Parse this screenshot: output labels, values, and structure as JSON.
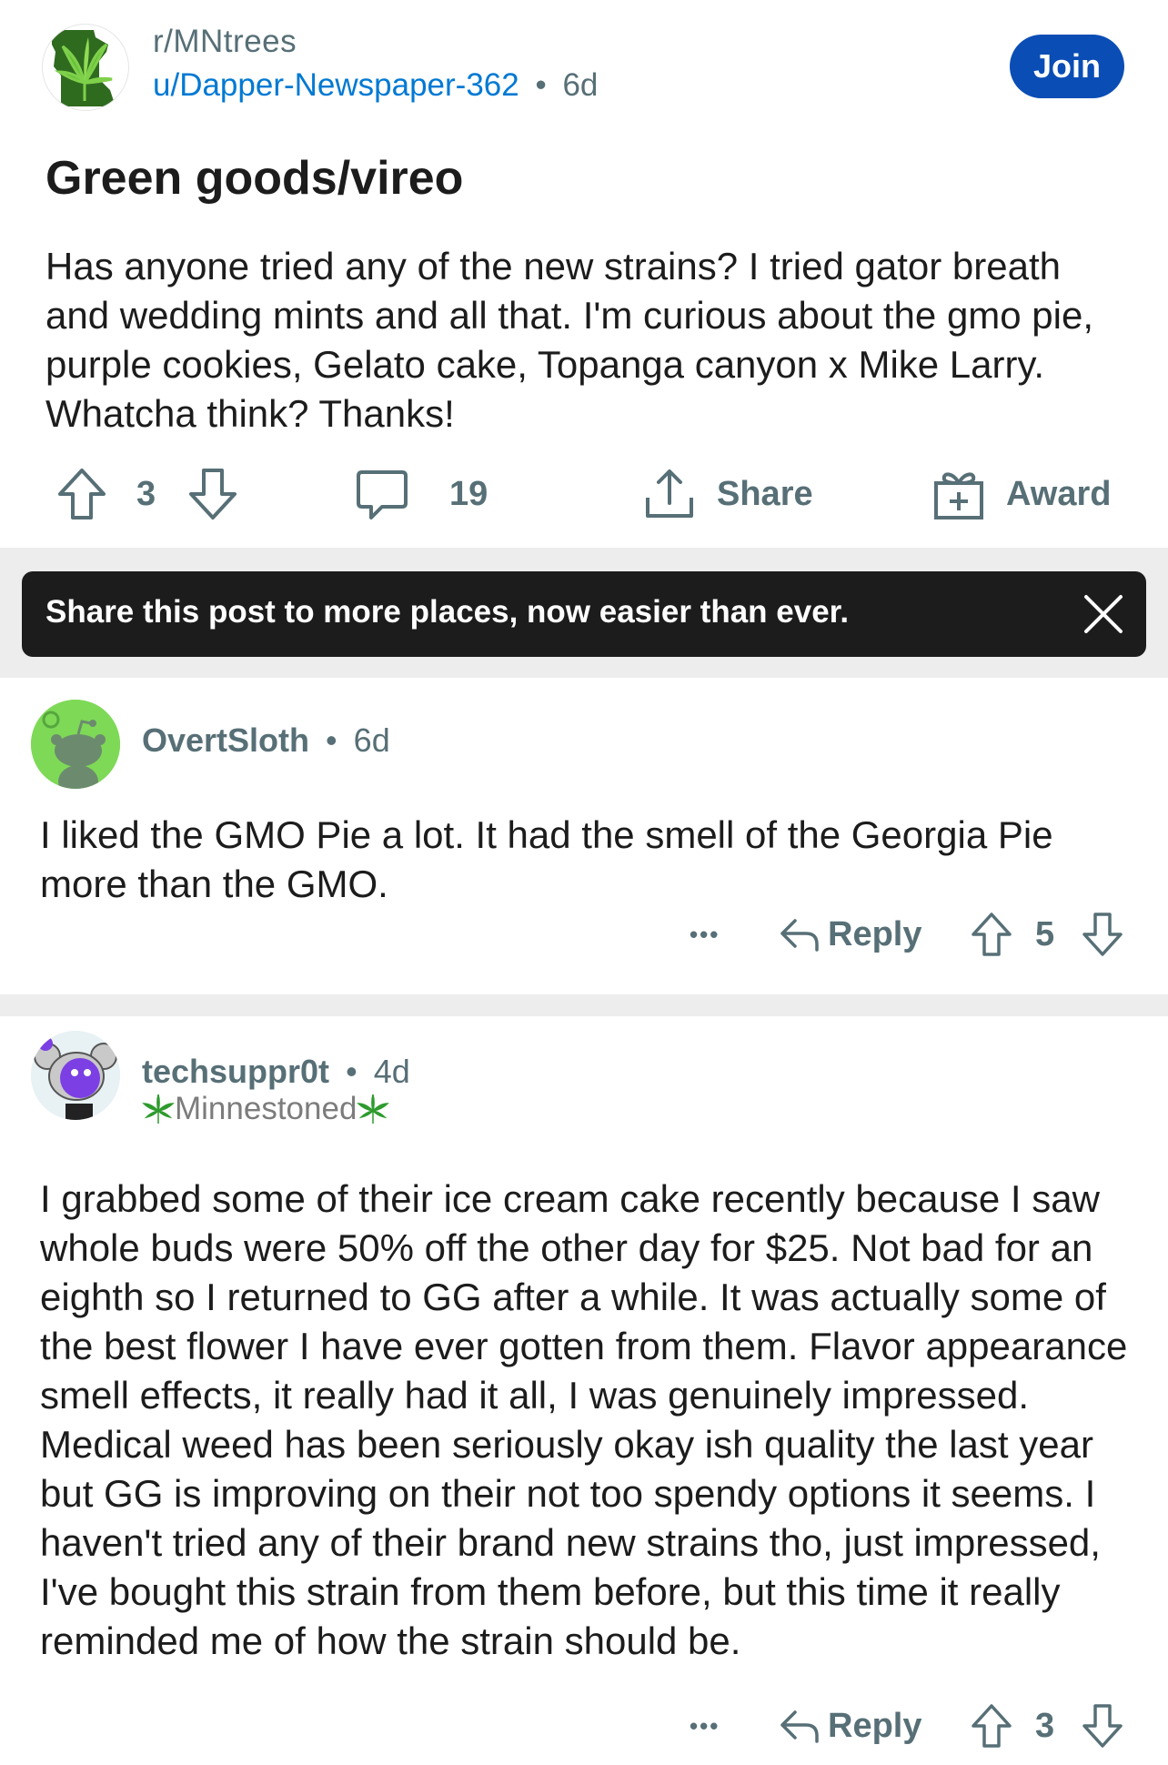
{
  "post": {
    "subreddit": "r/MNtrees",
    "author": "u/Dapper-Newspaper-362",
    "separator": "•",
    "age": "6d",
    "join_label": "Join",
    "title": "Green goods/vireo",
    "body": "Has anyone tried any of the new strains? I tried gator breath and wedding mints and all that. I'm curious about the gmo pie, purple cookies, Gelato cake, Topanga canyon x Mike Larry. Whatcha think? Thanks!",
    "score": "3",
    "comment_count": "19",
    "share_label": "Share",
    "award_label": "Award"
  },
  "banner": {
    "text": "Share this post to more places, now easier than ever."
  },
  "comments": [
    {
      "username": "OvertSloth",
      "separator": "•",
      "age": "6d",
      "body": "I liked the GMO Pie a lot.  It had the smell of the Georgia Pie more than the GMO.",
      "more_label": "•••",
      "reply_label": "Reply",
      "score": "5"
    },
    {
      "username": "techsuppr0t",
      "separator": "•",
      "age": "4d",
      "flair": "Minnestoned",
      "body": "I grabbed some of their ice cream cake recently because I saw whole buds were 50% off the other day for $25. Not bad for an eighth so I returned to GG after a while. It was actually some of the best flower I have ever gotten from them. Flavor appearance smell effects, it really had it all, I was genuinely impressed. Medical weed has been seriously okay ish quality the last year but GG is improving on their not too spendy options it seems. I haven't tried any of their brand new strains tho, just impressed, I've bought this strain from them before, but this time it really reminded me of how the strain should be.",
      "more_label": "•••",
      "reply_label": "Reply",
      "score": "3"
    }
  ],
  "icons": {
    "subreddit_avatar": "minnesota-cannabis-leaf-icon",
    "upvote": "arrow-up-outline-icon",
    "downvote": "arrow-down-outline-icon",
    "comment": "speech-bubble-icon",
    "share": "share-upload-icon",
    "award": "gift-box-icon",
    "close": "close-x-icon",
    "reply": "reply-arrow-icon",
    "flair_leaf": "cannabis-leaf-icon"
  },
  "colors": {
    "join_button": "#0a4db5",
    "author_link": "#0079d3",
    "meta_gray": "#576f76",
    "banner_bg": "#1c1c1c",
    "divider_bg": "#ededed",
    "comment1_avatar": "#7ed957",
    "comment2_avatar": "#e8f1f4",
    "leaf_green": "#2e9b2e"
  }
}
